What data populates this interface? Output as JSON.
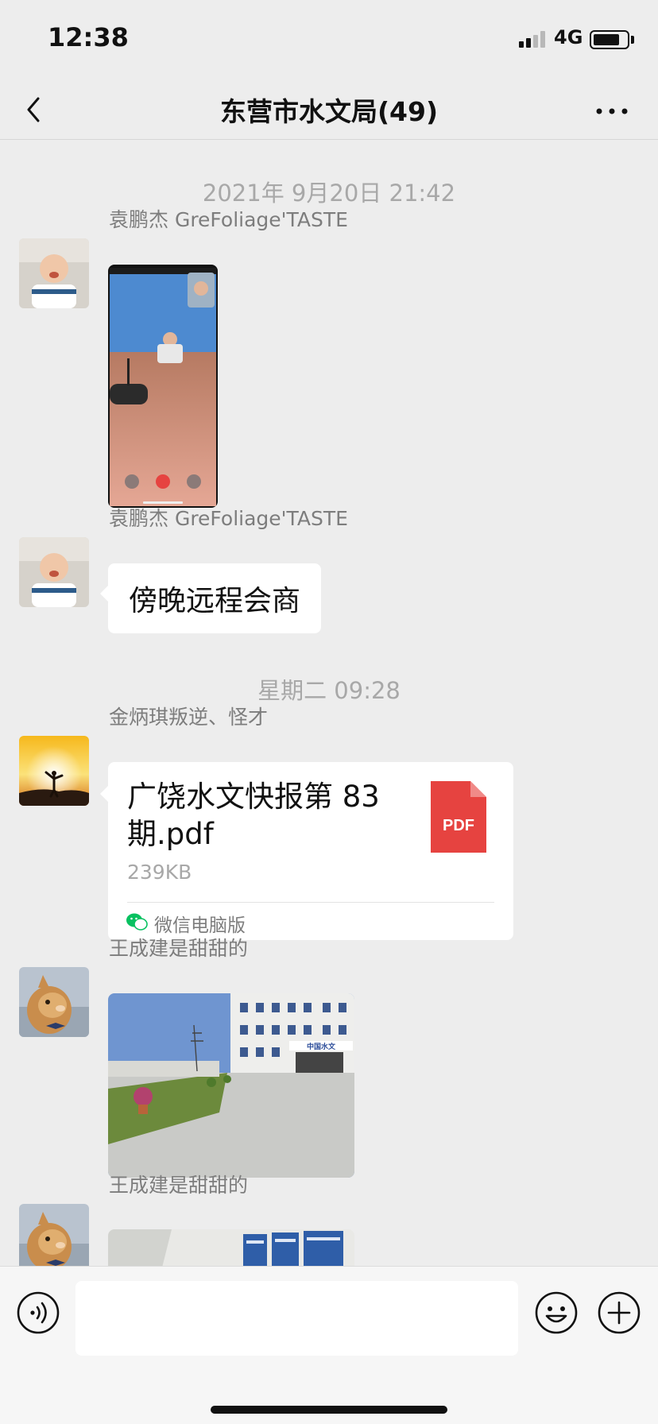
{
  "status_bar": {
    "time": "12:38",
    "network": "4G",
    "signal_bars": 2
  },
  "nav": {
    "title": "东营市水文局(49)"
  },
  "messages": {
    "ts1": "2021年 9月20日 21:42",
    "m1": {
      "sender": "袁鹏杰 GreFoliage'TASTE",
      "type": "image"
    },
    "m2": {
      "sender": "袁鹏杰 GreFoliage'TASTE",
      "text": "傍晚远程会商"
    },
    "ts2": "星期二 09:28",
    "m3": {
      "sender": "金炳琪叛逆、怪才",
      "file_name": "广饶水文快报第 83 期.pdf",
      "file_size": "239KB",
      "file_icon": "PDF",
      "source": "微信电脑版"
    },
    "m4": {
      "sender": "王成建是甜甜的",
      "type": "image",
      "sign_text": "中国水文"
    },
    "m5": {
      "sender": "王成建是甜甜的",
      "type": "image"
    }
  },
  "colors": {
    "background": "#ededed",
    "bubble": "#ffffff",
    "pdf_red": "#e64340",
    "wechat_green": "#07c160"
  }
}
